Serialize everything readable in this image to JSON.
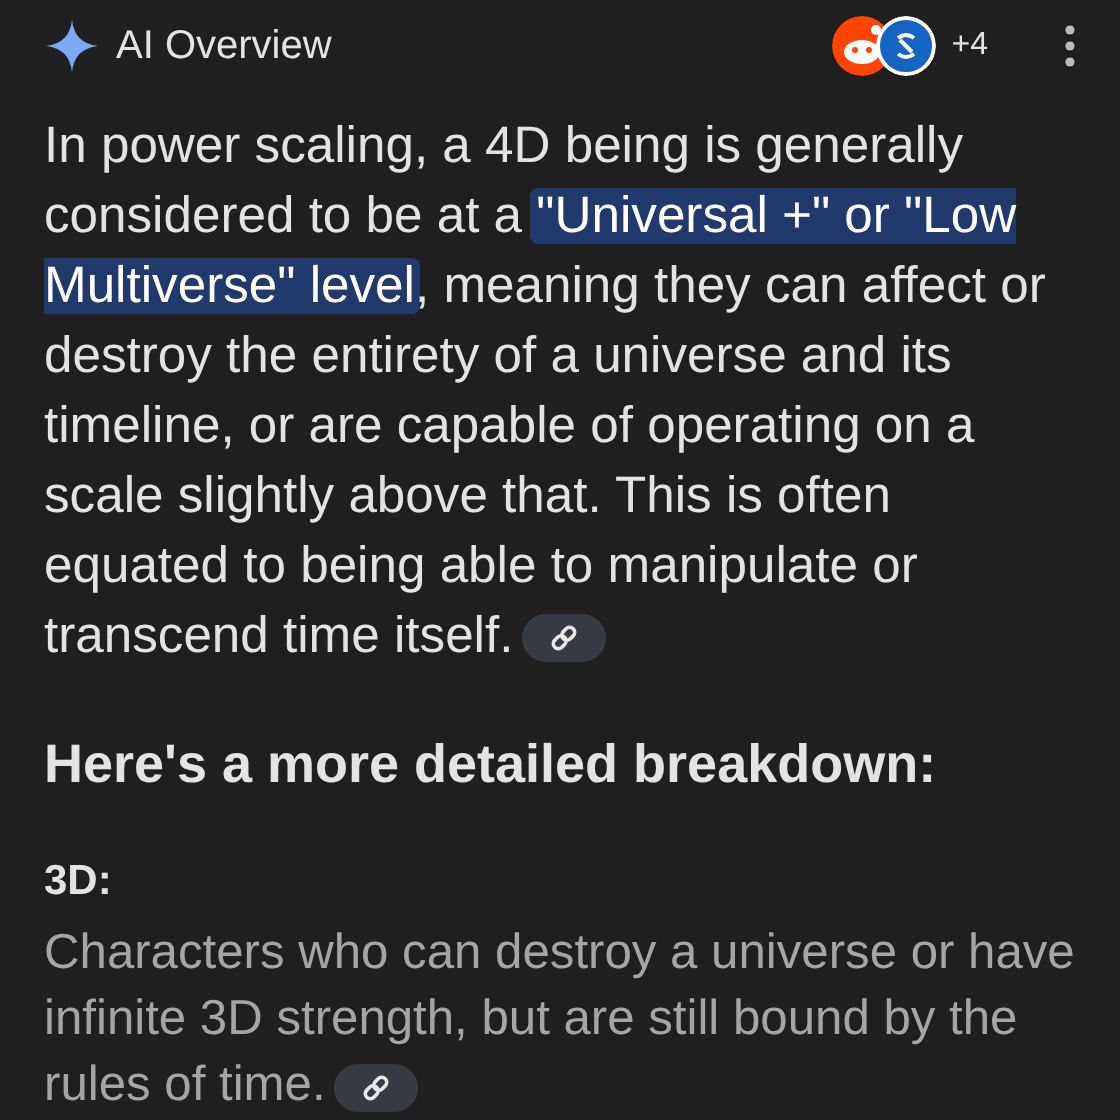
{
  "header": {
    "title": "AI Overview",
    "source_count": "+4"
  },
  "summary": {
    "segments": [
      {
        "text": "In power scaling, a 4D being is generally considered to be at a ",
        "highlighted": false
      },
      {
        "text": "\"Universal +\" or \"Low Multiverse\" level",
        "highlighted": true
      },
      {
        "text": ", meaning they can affect or destroy the entirety of a universe and its timeline, or are capable of operating on a scale slightly above that. This is often equated to being able to manipulate or transcend time itself.",
        "highlighted": false
      }
    ],
    "has_link": true
  },
  "breakdown_heading": "Here's a more detailed breakdown:",
  "sections": [
    {
      "title": "3D:",
      "text": "Characters who can destroy a universe or have infinite 3D strength, but are still bound by the rules of time.",
      "has_link": true
    }
  ]
}
